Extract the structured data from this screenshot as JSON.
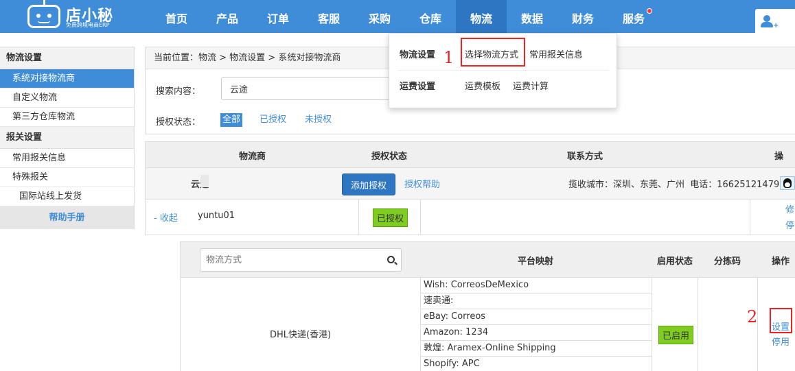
{
  "logo": {
    "name": "店小秘",
    "sub": "免费跨境电商ERP"
  },
  "nav": [
    "首页",
    "产品",
    "订单",
    "客服",
    "采购",
    "仓库",
    "物流",
    "数据",
    "财务",
    "服务"
  ],
  "dropdown": {
    "group1": "物流设置",
    "opt1": "选择物流方式",
    "opt2": "常用报关信息",
    "group2": "运费设置",
    "opt3": "运费模板",
    "opt4": "运费计算"
  },
  "sidebar": {
    "group1": "物流设置",
    "items1": [
      "系统对接物流商",
      "自定义物流",
      "第三方仓库物流"
    ],
    "group2": "报关设置",
    "items2": [
      "常用报关信息",
      "特殊报关"
    ],
    "sub": "国际站线上发货",
    "help": "帮助手册"
  },
  "breadcrumb": "当前位置：物流 > 物流设置 > 系统对接物流商",
  "search": {
    "label": "搜索内容：",
    "value": "云途"
  },
  "auth": {
    "label": "授权状态：",
    "tabs": [
      "全部",
      "已授权",
      "未授权"
    ]
  },
  "provider_table": {
    "headers": [
      "物流商",
      "授权状态",
      "联系方式",
      "操"
    ],
    "row1": {
      "name": "云途",
      "add_btn": "添加授权",
      "help": "授权帮助",
      "contact": "揽收城市：深圳、东莞、广州  电话：16625121479"
    },
    "row2": {
      "toggle": "- 收起",
      "account": "yuntu01",
      "status": "已授权",
      "op1": "修",
      "op2": "停"
    }
  },
  "method_table": {
    "search_placeholder": "物流方式",
    "headers": [
      "平台映射",
      "启用状态",
      "分拣码",
      "操作"
    ],
    "method": "DHL快递(香港)",
    "mappings": [
      "Wish:  CorreosDeMexico",
      "速卖通:",
      "eBay:  Correos",
      "Amazon:  1234",
      "敦煌:  Aramex-Online Shipping",
      "Shopify:  APC"
    ],
    "status": "已启用",
    "op_set": "设置",
    "op_stop": "停用"
  },
  "annotations": [
    "1",
    "2"
  ]
}
